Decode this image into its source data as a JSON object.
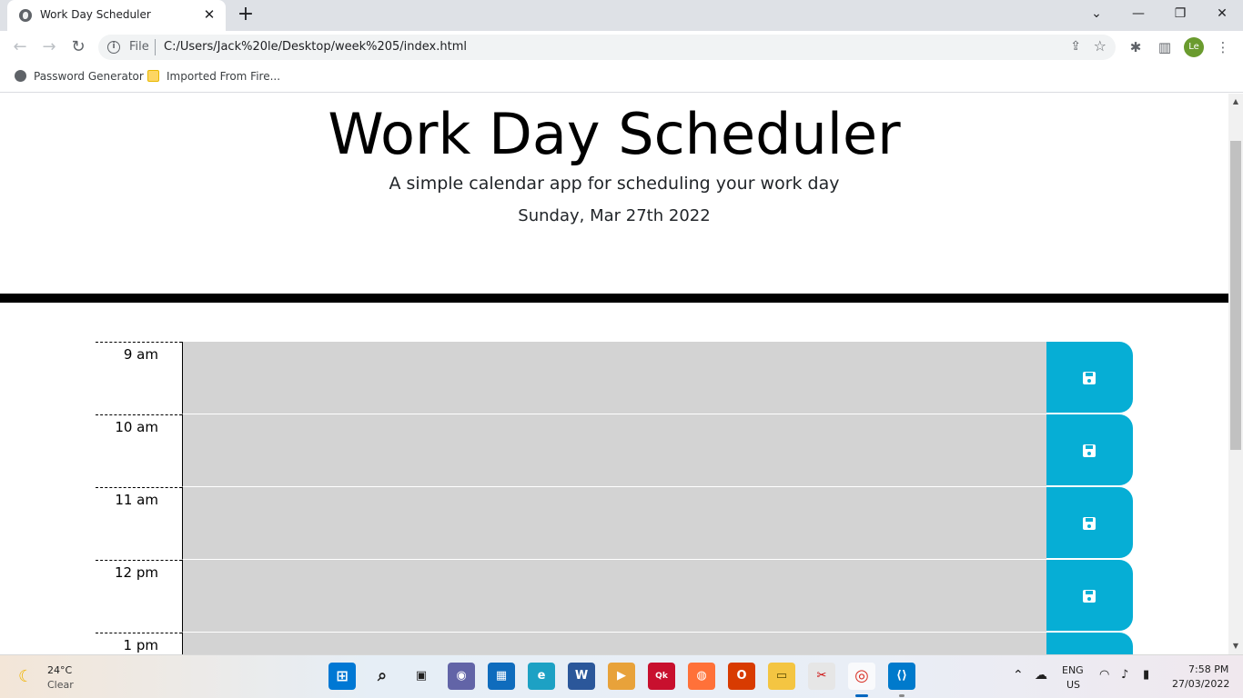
{
  "browser": {
    "tab_title": "Work Day Scheduler",
    "tab_close": "✕",
    "new_tab": "+",
    "win_minimize": "—",
    "win_restore": "❐",
    "win_close": "✕",
    "win_dropdown": "⌄",
    "scheme": "File",
    "url": "C:/Users/Jack%20le/Desktop/week%205/index.html",
    "profile_initials": "Le",
    "bookmarks": [
      "Password Generator",
      "Imported From Fire..."
    ]
  },
  "page": {
    "title": "Work Day Scheduler",
    "lead": "A simple calendar app for scheduling your work day",
    "current_day": "Sunday, Mar 27th 2022"
  },
  "hours": [
    {
      "label": "9 am",
      "text": ""
    },
    {
      "label": "10 am",
      "text": ""
    },
    {
      "label": "11 am",
      "text": ""
    },
    {
      "label": "12 pm",
      "text": ""
    },
    {
      "label": "1 pm",
      "text": ""
    }
  ],
  "taskbar": {
    "weather_temp": "24°C",
    "weather_cond": "Clear",
    "lang_1": "ENG",
    "lang_2": "US",
    "time": "7:58 PM",
    "date": "27/03/2022"
  },
  "colors": {
    "save_button": "#06aed5",
    "past_block": "#d3d3d3"
  }
}
